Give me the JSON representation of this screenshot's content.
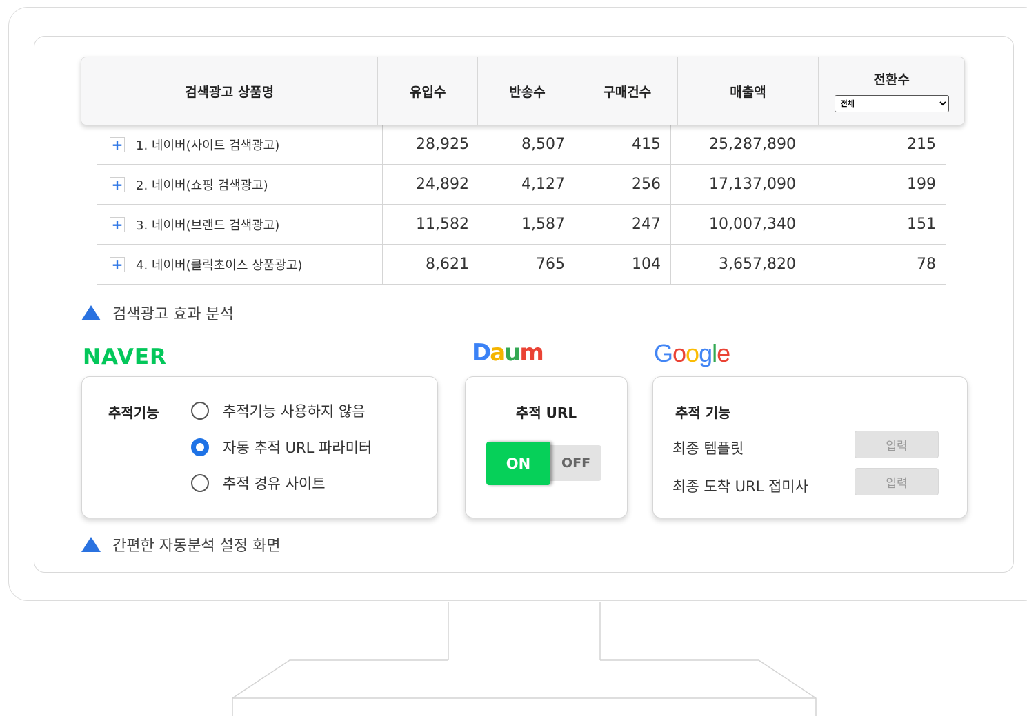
{
  "table": {
    "headers": [
      "검색광고 상품명",
      "유입수",
      "반송수",
      "구매건수",
      "매출액",
      "전환수"
    ],
    "conversion_filter": {
      "selected": "전체"
    },
    "rows": [
      {
        "name": "1. 네이버(사이트 검색광고)",
        "inflow": "28,925",
        "bounce": "8,507",
        "purchases": "415",
        "sales": "25,287,890",
        "conversions": "215"
      },
      {
        "name": "2. 네이버(쇼핑 검색광고)",
        "inflow": "24,892",
        "bounce": "4,127",
        "purchases": "256",
        "sales": "17,137,090",
        "conversions": "199"
      },
      {
        "name": "3. 네이버(브랜드 검색광고)",
        "inflow": "11,582",
        "bounce": "1,587",
        "purchases": "247",
        "sales": "10,007,340",
        "conversions": "151"
      },
      {
        "name": "4. 네이버(클릭초이스 상품광고)",
        "inflow": "8,621",
        "bounce": "765",
        "purchases": "104",
        "sales": "3,657,820",
        "conversions": "78"
      }
    ],
    "expand_icon": "plus-icon"
  },
  "caption_analysis": "검색광고 효과 분석",
  "caption_settings": "간편한 자동분석 설정 화면",
  "logos": {
    "naver": "NAVER",
    "daum": "Daum",
    "google": "Google"
  },
  "naver_card": {
    "label": "추적기능",
    "options": [
      "추적기능 사용하지 않음",
      "자동 추적 URL 파라미터",
      "추적 경유 사이트"
    ],
    "selected_index": 1
  },
  "daum_card": {
    "label": "추적 URL",
    "toggle_on": "ON",
    "toggle_off": "OFF",
    "state": "ON"
  },
  "google_card": {
    "label": "추적 기능",
    "rows": [
      {
        "label": "최종 템플릿",
        "button": "입력"
      },
      {
        "label": "최종 도착 URL 접미사",
        "button": "입력"
      }
    ]
  },
  "colors": {
    "naver_green": "#03c75a",
    "accent_blue": "#2a72e0",
    "toggle_on": "#06d059",
    "google_blue": "#4285f4",
    "google_red": "#ea4335",
    "google_yellow": "#fbbc05",
    "google_green": "#34a853"
  }
}
